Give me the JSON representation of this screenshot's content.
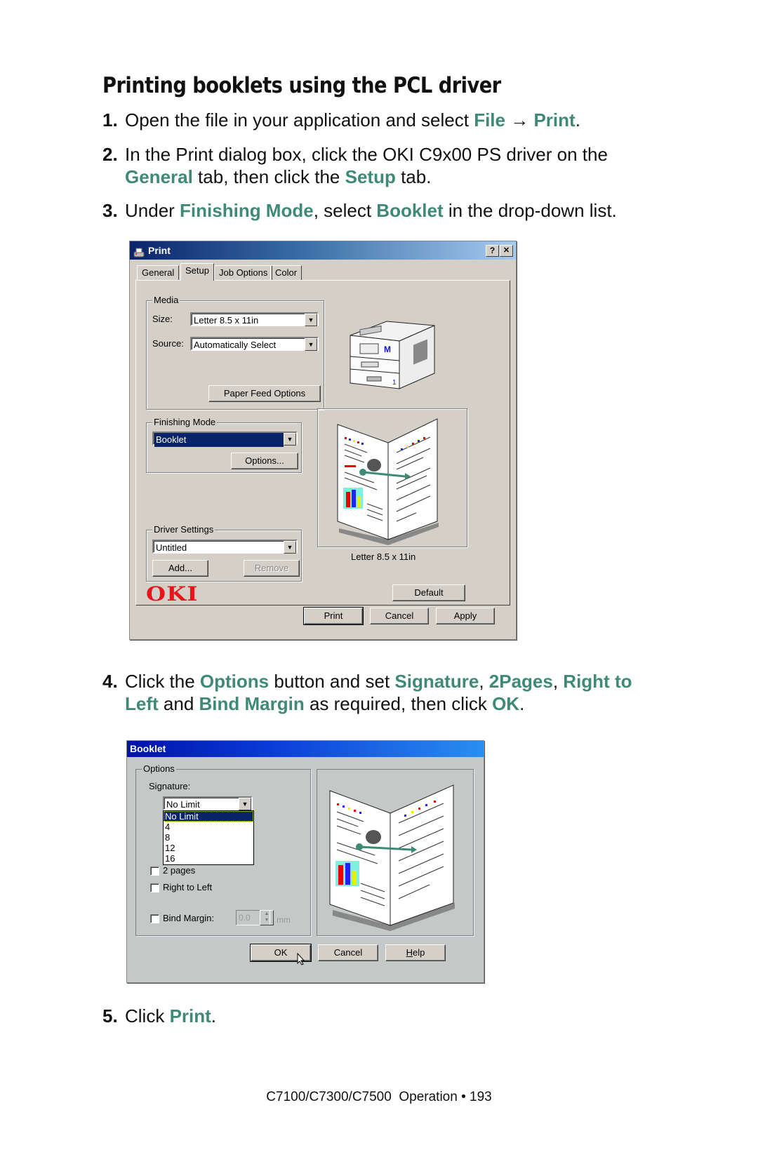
{
  "heading": "Printing booklets using the PCL driver",
  "steps": [
    {
      "number": "1.",
      "parts": [
        "Open the file in your application and select ",
        "File",
        " → ",
        "Print",
        "."
      ]
    },
    {
      "number": "2.",
      "line1": "In the Print dialog box, click the OKI C9x00 PS driver on the",
      "line2_parts": [
        "General",
        " tab, then click the ",
        "Setup",
        " tab."
      ]
    },
    {
      "number": "3.",
      "parts": [
        "Under ",
        "Finishing Mode",
        ", select ",
        "Booklet",
        " in the drop-down list."
      ]
    },
    {
      "number": "4.",
      "line1_parts": [
        "Click the ",
        "Options",
        " button and set ",
        "Signature",
        ", ",
        "2Pages",
        ", ",
        "Right to"
      ],
      "line2_parts": [
        "Left",
        " and ",
        "Bind Margin",
        " as required, then click ",
        "OK",
        "."
      ]
    },
    {
      "number": "5.",
      "parts": [
        "Click ",
        "Print",
        "."
      ]
    }
  ],
  "print_dialog": {
    "title": "Print",
    "help_button": "?",
    "close_button": "✕",
    "tabs": [
      "General",
      "Setup",
      "Job Options",
      "Color"
    ],
    "active_tab": "Setup",
    "media": {
      "legend": "Media",
      "size_label": "Size:",
      "size_value": "Letter 8.5 x 11in",
      "source_label": "Source:",
      "source_value": "Automatically Select",
      "paper_feed_button": "Paper Feed Options"
    },
    "printer_image": {
      "label_m": "M",
      "label_tray": "1"
    },
    "finishing": {
      "legend": "Finishing Mode",
      "value": "Booklet",
      "options_button": "Options..."
    },
    "driver_settings": {
      "legend": "Driver Settings",
      "value": "Untitled",
      "add_button": "Add...",
      "remove_button": "Remove"
    },
    "preview_caption": "Letter 8.5 x 11in",
    "logo": "OKI",
    "default_button": "Default",
    "buttons": {
      "print": "Print",
      "cancel": "Cancel",
      "apply": "Apply"
    }
  },
  "booklet_dialog": {
    "title": "Booklet",
    "options_legend": "Options",
    "signature_label": "Signature:",
    "signature_value": "No Limit",
    "signature_options": [
      "No Limit",
      "4",
      "8",
      "12",
      "16"
    ],
    "signature_highlighted": "No Limit",
    "two_pages_label": "2 pages",
    "right_to_left_label": "Right to Left",
    "bind_margin_label": "Bind Margin:",
    "bind_margin_value": "0.0",
    "bind_margin_unit": "mm",
    "buttons": {
      "ok": "OK",
      "cancel": "Cancel",
      "help": "Help"
    }
  },
  "colors": {
    "highlight_text": "#3f8a76",
    "selection": "#0a246a",
    "oki_red": "#e8141a"
  },
  "footer": "C7100/C7300/C7500  Operation • 193"
}
